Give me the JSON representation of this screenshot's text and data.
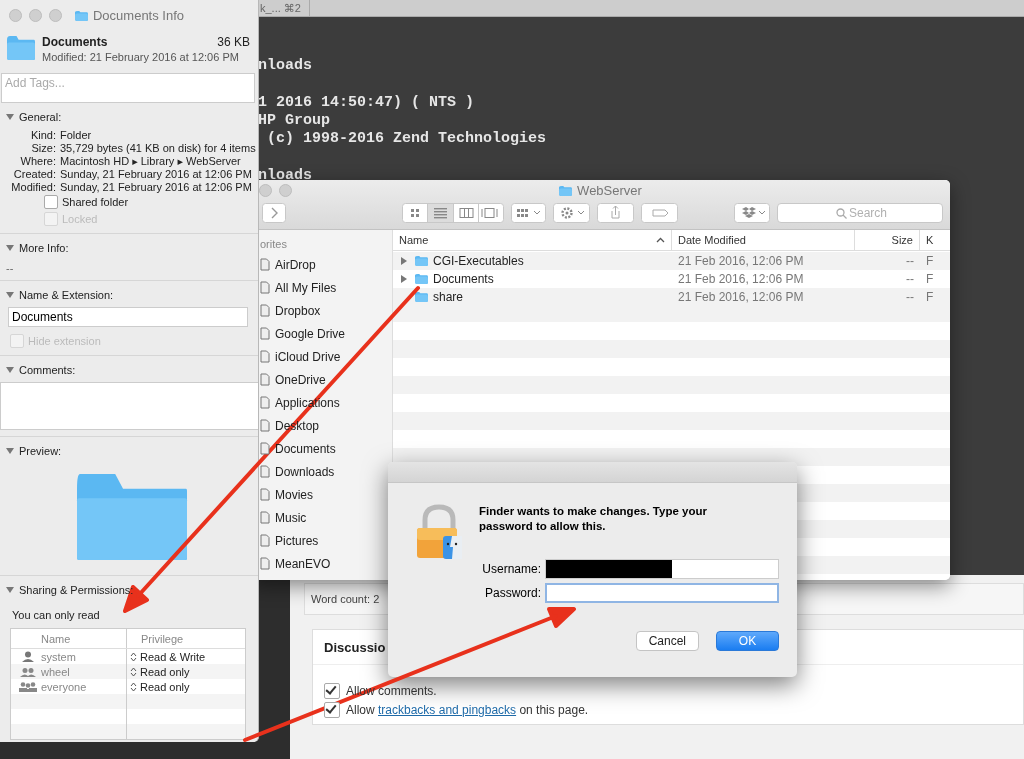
{
  "terminal": {
    "tab": "k_... ⌘2",
    "blocks": [
      {
        "lines": [
          "nloads"
        ]
      },
      {
        "lines": [
          "1 2016 14:50:47) ( NTS )",
          "HP Group",
          " (c) 1998-2016 Zend Technologies"
        ]
      },
      {
        "lines": [
          "nloads"
        ]
      }
    ]
  },
  "web_page": {
    "word_count": "Word count: 2",
    "discussion_heading": "Discussio",
    "options": [
      {
        "before": "Allow comments.",
        "checked": true
      },
      {
        "before": "Allow ",
        "link": "trackbacks and pingbacks",
        "after": " on this page.",
        "checked": true
      }
    ]
  },
  "info_window": {
    "title": "Documents Info",
    "name": "Documents",
    "size": "36 KB",
    "modified": "Modified: 21 February 2016 at 12:06 PM",
    "tags_placeholder": "Add Tags...",
    "sections": [
      {
        "kind": "general",
        "label": "General:",
        "expanded": true,
        "rows": [
          {
            "key": "Kind:",
            "value": "Folder"
          },
          {
            "key": "Size:",
            "value": "35,729 bytes (41 KB on disk) for 4 items"
          },
          {
            "key": "Where:",
            "value": "Macintosh HD ▸ Library ▸ WebServer"
          },
          {
            "key": "Created:",
            "value": "Sunday, 21 February 2016 at 12:06 PM"
          },
          {
            "key": "Modified:",
            "value": "Sunday, 21 February 2016 at 12:06 PM"
          }
        ],
        "checkboxes": [
          {
            "label": "Shared folder",
            "checked": false,
            "disabled": false
          },
          {
            "label": "Locked",
            "checked": false,
            "disabled": true
          }
        ]
      },
      {
        "kind": "more_info",
        "label": "More Info:",
        "expanded": true,
        "value": "--"
      },
      {
        "kind": "name_extension",
        "label": "Name & Extension:",
        "expanded": true,
        "value": "Documents",
        "checkbox": {
          "label": "Hide extension",
          "checked": false,
          "disabled": true
        }
      },
      {
        "kind": "comments",
        "label": "Comments:",
        "expanded": true
      },
      {
        "kind": "preview",
        "label": "Preview:",
        "expanded": true
      },
      {
        "kind": "sharing",
        "label": "Sharing & Permissions:",
        "expanded": true,
        "note": "You can only read",
        "columns": [
          "Name",
          "Privilege"
        ],
        "rows": [
          {
            "name": "system",
            "kind": "single",
            "privilege": "Read & Write"
          },
          {
            "name": "wheel",
            "kind": "pair",
            "privilege": "Read only"
          },
          {
            "name": "everyone",
            "kind": "trio",
            "privilege": "Read only"
          }
        ]
      }
    ]
  },
  "finder": {
    "title": "WebServer",
    "search_placeholder": "Search",
    "sidebar_heading": "orites",
    "sidebar": [
      {
        "label": "AirDrop",
        "selected": false
      },
      {
        "label": "All My Files",
        "selected": false
      },
      {
        "label": "Dropbox",
        "selected": false
      },
      {
        "label": "Google Drive",
        "selected": false
      },
      {
        "label": "iCloud Drive",
        "selected": false
      },
      {
        "label": "OneDrive",
        "selected": false
      },
      {
        "label": "Applications",
        "selected": false
      },
      {
        "label": "Desktop",
        "selected": false
      },
      {
        "label": "Documents",
        "selected": false
      },
      {
        "label": "Downloads",
        "selected": false
      },
      {
        "label": "Movies",
        "selected": false
      },
      {
        "label": "Music",
        "selected": false
      },
      {
        "label": "Pictures",
        "selected": false
      },
      {
        "label": "MeanEVO",
        "selected": false
      }
    ],
    "columns": [
      "Name",
      "Date Modified",
      "Size",
      "K"
    ],
    "rows": [
      {
        "name": "CGI-Executables",
        "date": "21 Feb 2016, 12:06 PM",
        "size": "--",
        "column_4": "F",
        "expandable": true,
        "selected": false
      },
      {
        "name": "Documents",
        "date": "21 Feb 2016, 12:06 PM",
        "size": "--",
        "column_4": "F",
        "expandable": true,
        "selected": false
      },
      {
        "name": "share",
        "date": "21 Feb 2016, 12:06 PM",
        "size": "--",
        "column_4": "F",
        "expandable": false,
        "selected": false
      }
    ]
  },
  "dialog": {
    "message": "Finder wants to make changes. Type your password to allow this.",
    "username_label": "Username:",
    "password_label": "Password:",
    "password_focused": true,
    "buttons": [
      {
        "label": "Cancel",
        "default": false
      },
      {
        "label": "OK",
        "default": true
      }
    ]
  }
}
